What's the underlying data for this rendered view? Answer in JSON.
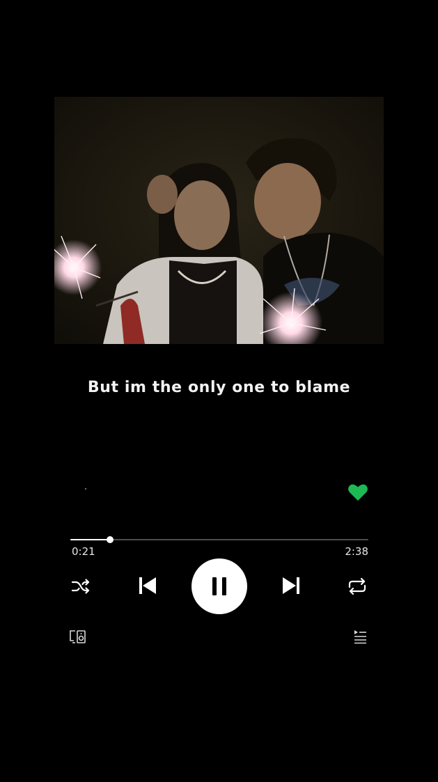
{
  "player": {
    "lyric_line": "But im the only one to blame",
    "elapsed": "0:21",
    "duration": "2:38",
    "progress_fraction": 0.133,
    "liked": true,
    "state": "playing"
  },
  "colors": {
    "background": "#000000",
    "accent_heart": "#1db954",
    "text": "#ffffff",
    "track": "#4d4d4d"
  },
  "icons": {
    "like": "heart-icon",
    "shuffle": "shuffle-icon",
    "previous": "skip-previous-icon",
    "pause": "pause-icon",
    "next": "skip-next-icon",
    "repeat": "repeat-icon",
    "devices": "devices-icon",
    "queue": "queue-icon"
  }
}
